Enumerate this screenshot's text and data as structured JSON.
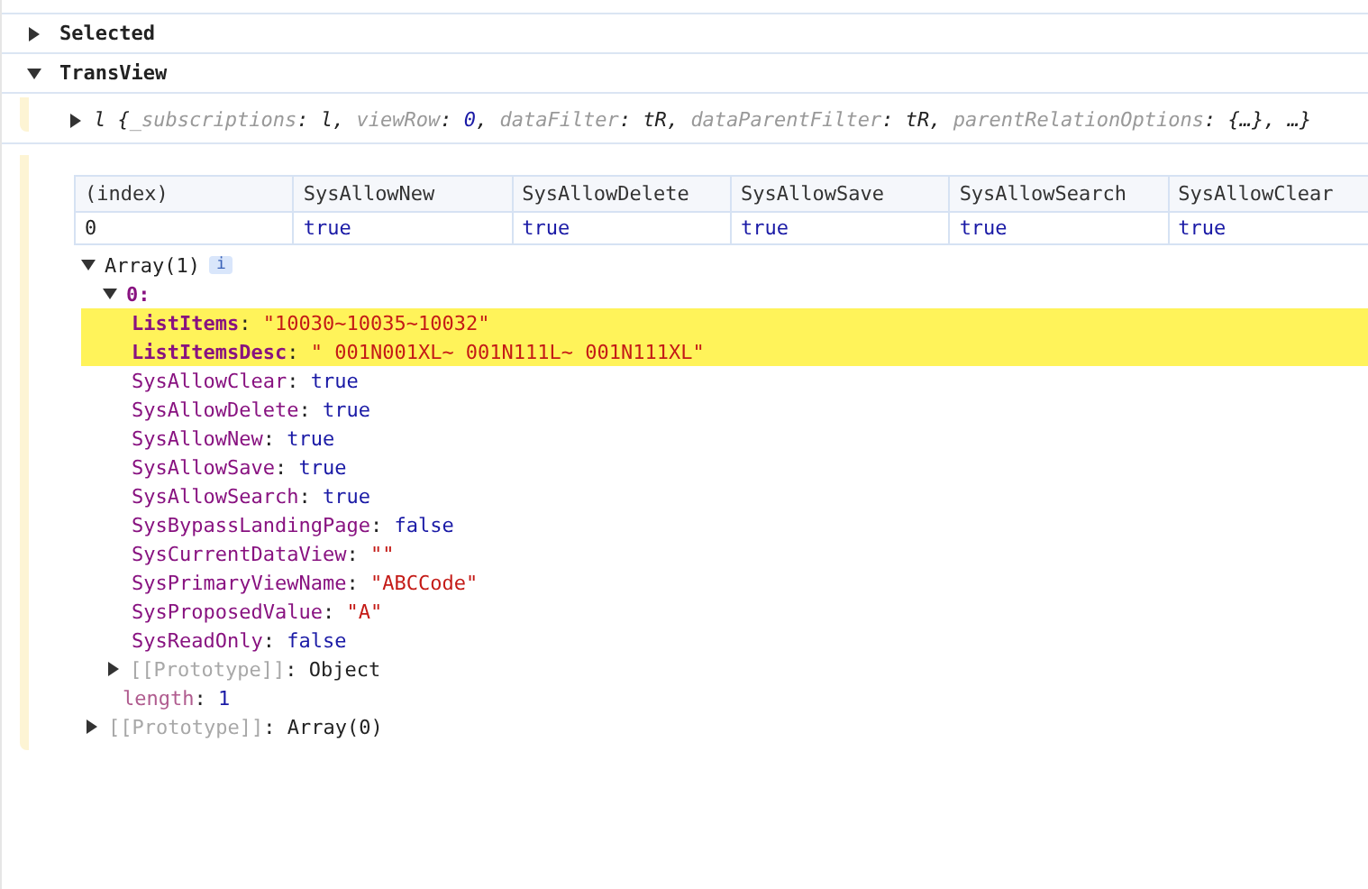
{
  "separator": ":",
  "comma": ",",
  "groups": [
    {
      "label": "Selected",
      "expanded": false
    },
    {
      "label": "TransView",
      "expanded": true
    }
  ],
  "summary": {
    "expanded": false,
    "class_name": "l",
    "open": "{",
    "close": "}",
    "props": [
      {
        "name": "_subscriptions",
        "value": "l",
        "kind": "ref"
      },
      {
        "name": "viewRow",
        "value": "0",
        "kind": "number"
      },
      {
        "name": "dataFilter",
        "value": "tR",
        "kind": "ref"
      },
      {
        "name": "dataParentFilter",
        "value": "tR",
        "kind": "ref"
      },
      {
        "name": "parentRelationOptions",
        "value": "{…}",
        "kind": "ref"
      }
    ],
    "more": "…"
  },
  "table": {
    "columns": [
      "(index)",
      "SysAllowNew",
      "SysAllowDelete",
      "SysAllowSave",
      "SysAllowSearch",
      "SysAllowClear"
    ],
    "rows": [
      [
        "0",
        "true",
        "true",
        "true",
        "true",
        "true"
      ]
    ]
  },
  "array": {
    "label": "Array(1)",
    "expanded": true,
    "badge": "i",
    "item": {
      "key": "0",
      "expanded": true,
      "props": [
        {
          "name": "ListItems",
          "value": "\"10030~10035~10032\"",
          "kind": "string",
          "highlighted": true
        },
        {
          "name": "ListItemsDesc",
          "value": "\" 001N001XL~ 001N111L~ 001N111XL\"",
          "kind": "string",
          "highlighted": true
        },
        {
          "name": "SysAllowClear",
          "value": "true",
          "kind": "boolean",
          "highlighted": false
        },
        {
          "name": "SysAllowDelete",
          "value": "true",
          "kind": "boolean",
          "highlighted": false
        },
        {
          "name": "SysAllowNew",
          "value": "true",
          "kind": "boolean",
          "highlighted": false
        },
        {
          "name": "SysAllowSave",
          "value": "true",
          "kind": "boolean",
          "highlighted": false
        },
        {
          "name": "SysAllowSearch",
          "value": "true",
          "kind": "boolean",
          "highlighted": false
        },
        {
          "name": "SysBypassLandingPage",
          "value": "false",
          "kind": "boolean",
          "highlighted": false
        },
        {
          "name": "SysCurrentDataView",
          "value": "\"\"",
          "kind": "string",
          "highlighted": false
        },
        {
          "name": "SysPrimaryViewName",
          "value": "\"ABCCode\"",
          "kind": "string",
          "highlighted": false
        },
        {
          "name": "SysProposedValue",
          "value": "\"A\"",
          "kind": "string",
          "highlighted": false
        },
        {
          "name": "SysReadOnly",
          "value": "false",
          "kind": "boolean",
          "highlighted": false
        }
      ],
      "prototype": {
        "name": "[[Prototype]]",
        "value": "Object",
        "expanded": false
      }
    },
    "length": {
      "name": "length",
      "value": "1"
    },
    "prototype": {
      "name": "[[Prototype]]",
      "value": "Array(0)",
      "expanded": false
    }
  }
}
